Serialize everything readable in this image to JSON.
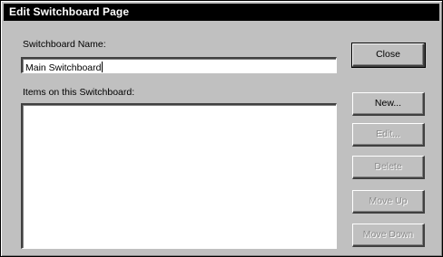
{
  "window": {
    "title": "Edit Switchboard Page"
  },
  "switchboard_name": {
    "label": "Switchboard Name:",
    "value": "Main Switchboard"
  },
  "items": {
    "label": "Items on this Switchboard:",
    "list": []
  },
  "buttons": {
    "close": "Close",
    "new": "New...",
    "edit": "Edit...",
    "delete": "Delete",
    "move_up": "Move Up",
    "move_down": "Move Down"
  }
}
